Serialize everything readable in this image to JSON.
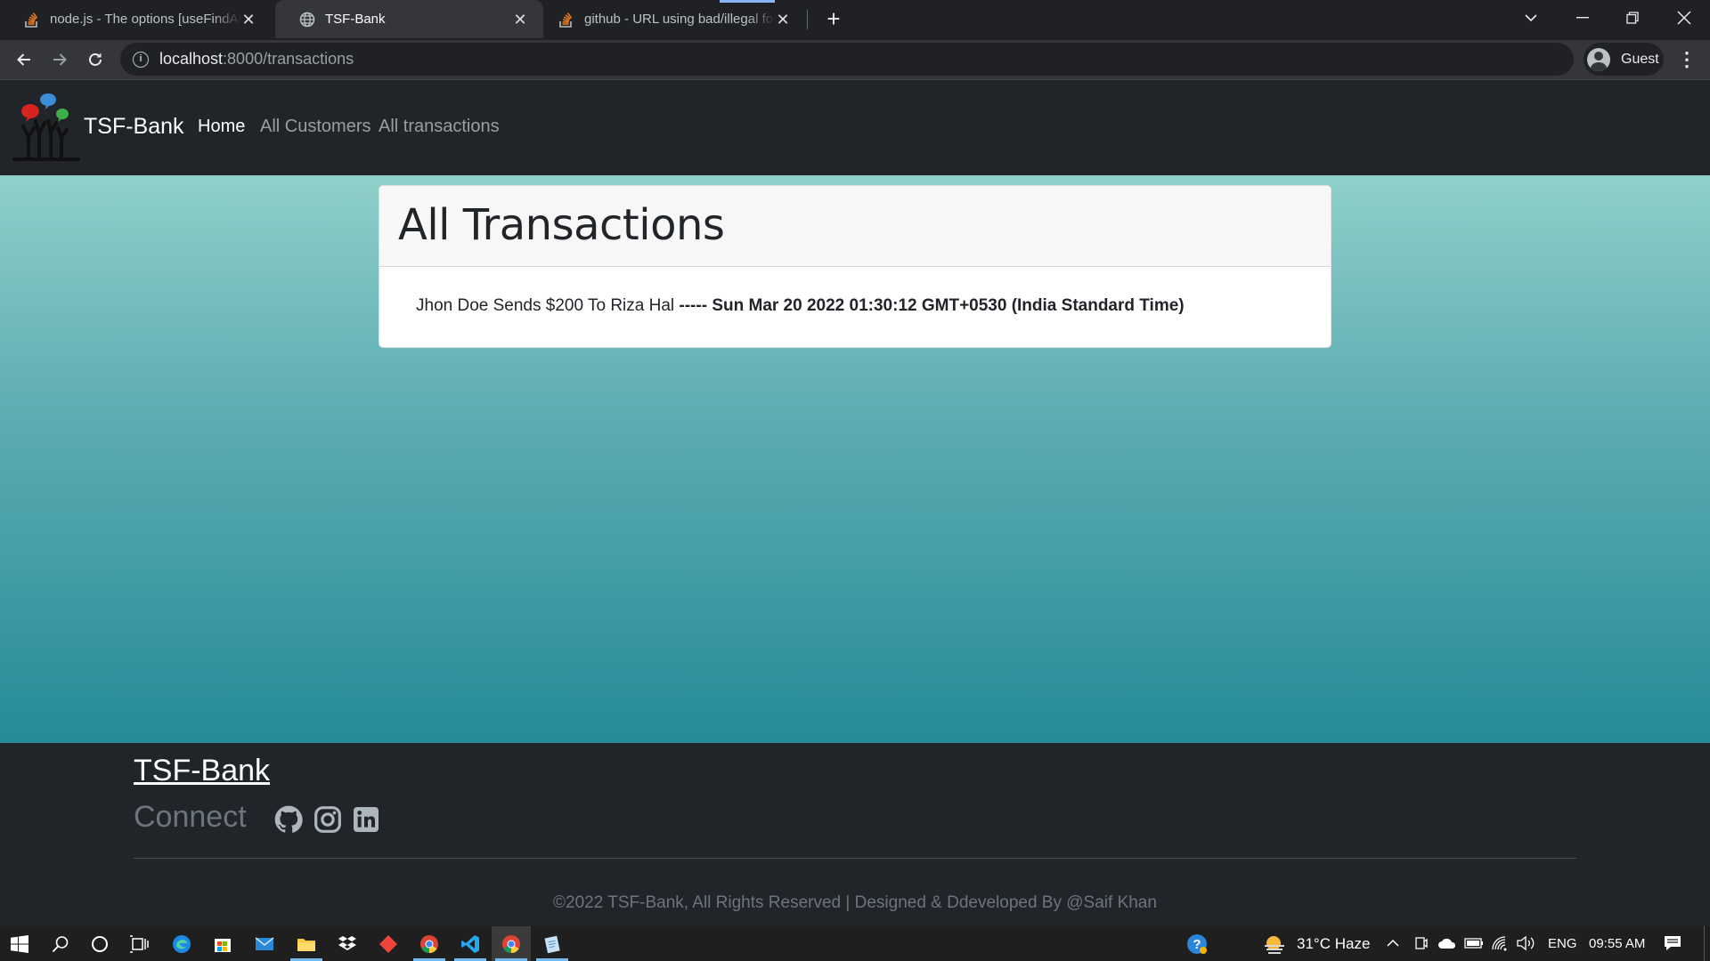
{
  "browser": {
    "tabs": [
      {
        "title": "node.js - The options [useFindAndModify]",
        "favicon": "stackoverflow-icon",
        "active": false
      },
      {
        "title": "TSF-Bank",
        "favicon": "globe-icon",
        "active": true
      },
      {
        "title": "github - URL using bad/illegal format",
        "favicon": "stackoverflow-icon",
        "active": false
      }
    ],
    "url_host": "localhost",
    "url_path": ":8000/transactions",
    "profile_label": "Guest"
  },
  "site": {
    "brand": "TSF-Bank",
    "nav": [
      {
        "label": "Home",
        "current": true
      },
      {
        "label": "All Customers",
        "current": false
      },
      {
        "label": "All transactions",
        "current": false
      }
    ]
  },
  "main": {
    "title": "All Transactions",
    "transactions": [
      {
        "text": "Jhon Doe Sends $200 To Riza Hal",
        "separator": "-----",
        "date": "Sun Mar 20 2022 01:30:12 GMT+0530 (India Standard Time)"
      }
    ]
  },
  "footer": {
    "brand": "TSF-Bank",
    "connect_label": "Connect",
    "social": [
      "github-icon",
      "instagram-icon",
      "linkedin-icon"
    ],
    "copyright": "©2022 TSF-Bank, All Rights Reserved | Designed & Ddeveloped By @Saif Khan"
  },
  "taskbar": {
    "weather": "31°C  Haze",
    "lang": "ENG",
    "time": "09:55 AM"
  },
  "colors": {
    "navbar_bg": "#212529",
    "gradient_top": "#90d0ca",
    "gradient_bottom": "#268a98",
    "chrome_bg": "#202124",
    "chrome_toolbar": "#35363a"
  }
}
